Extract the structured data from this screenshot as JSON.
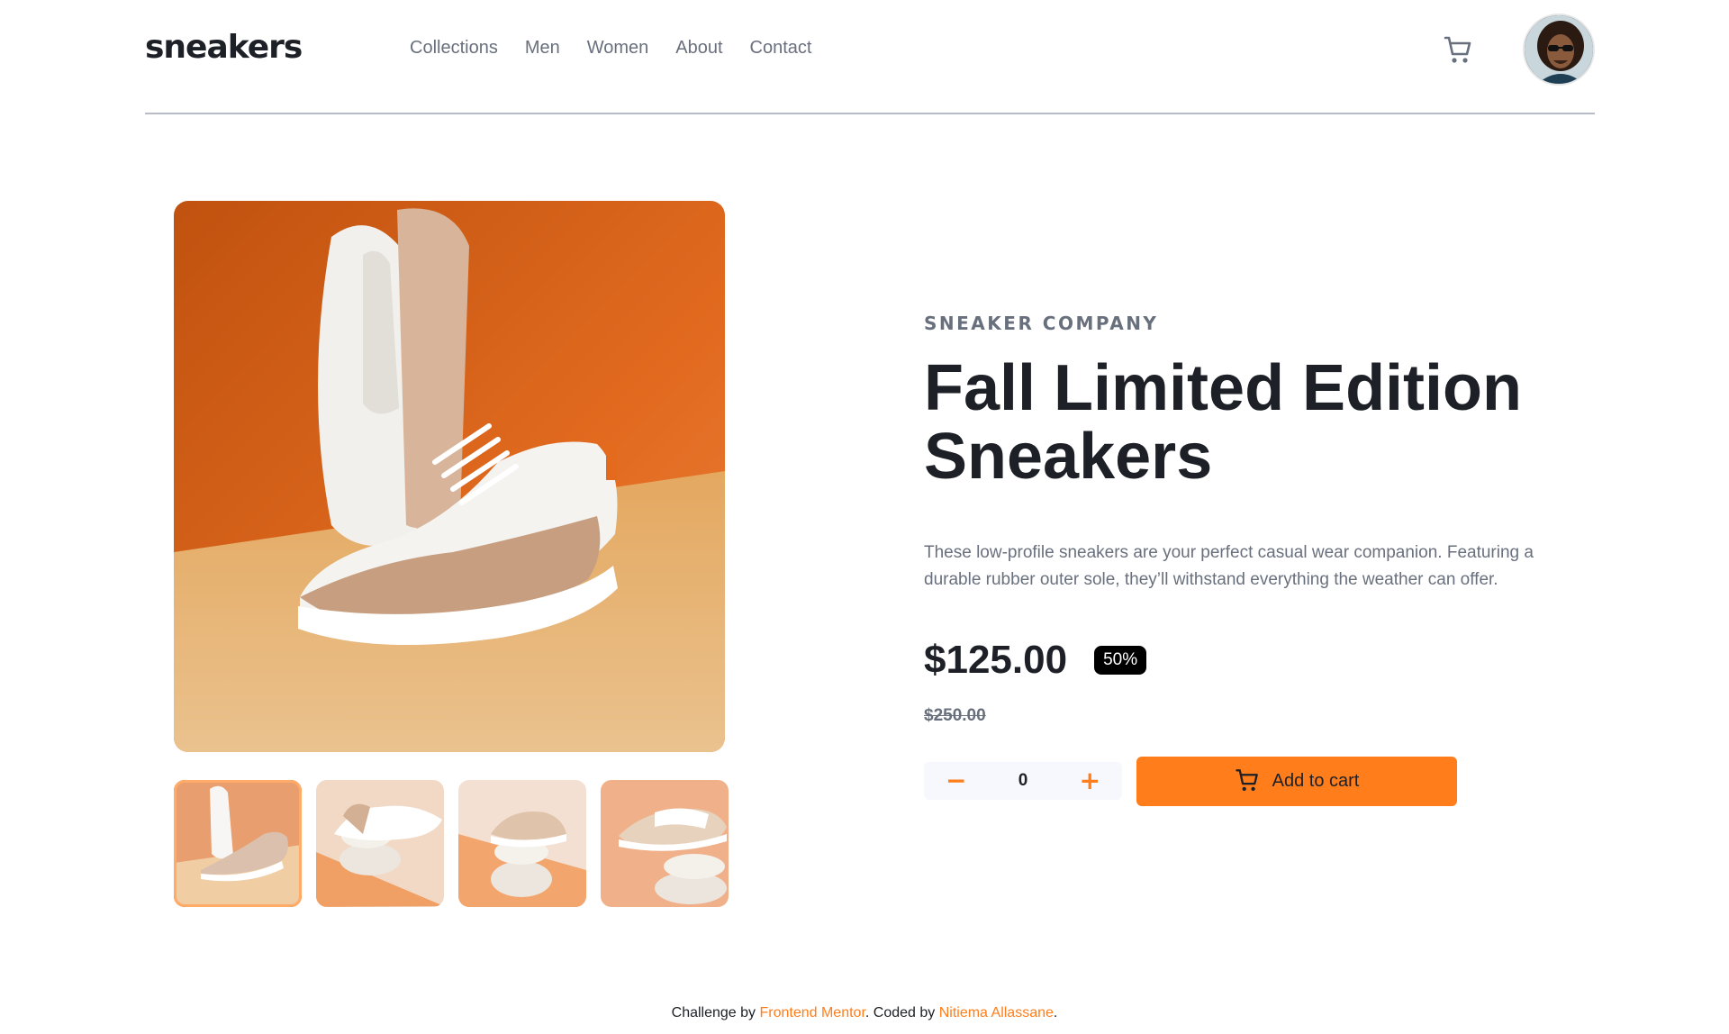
{
  "header": {
    "logo": "sneakers",
    "nav": [
      "Collections",
      "Men",
      "Women",
      "About",
      "Contact"
    ],
    "cart_icon": "cart-icon",
    "avatar_icon": "user-avatar"
  },
  "gallery": {
    "thumbnails": [
      "thumbnail-1",
      "thumbnail-2",
      "thumbnail-3",
      "thumbnail-4"
    ],
    "active_index": 0
  },
  "product": {
    "company": "SNEAKER COMPANY",
    "title": "Fall Limited Edition Sneakers",
    "description": "These low-profile sneakers are your perfect casual wear companion. Featuring a durable rubber outer sole, they’ll withstand everything the weather can offer.",
    "price": "$125.00",
    "discount": "50%",
    "old_price": "$250.00",
    "quantity": "0",
    "minus": "−",
    "plus": "+",
    "add_to_cart": "Add to cart"
  },
  "footer": {
    "prefix": "Challenge by ",
    "mentor": "Frontend Mentor",
    "middle": ". Coded by ",
    "author": "Nitiema Allassane",
    "suffix": "."
  },
  "colors": {
    "accent": "#ff7e1b",
    "text_dark": "#1d2026",
    "text_muted": "#69707d",
    "badge_bg": "#000000"
  }
}
